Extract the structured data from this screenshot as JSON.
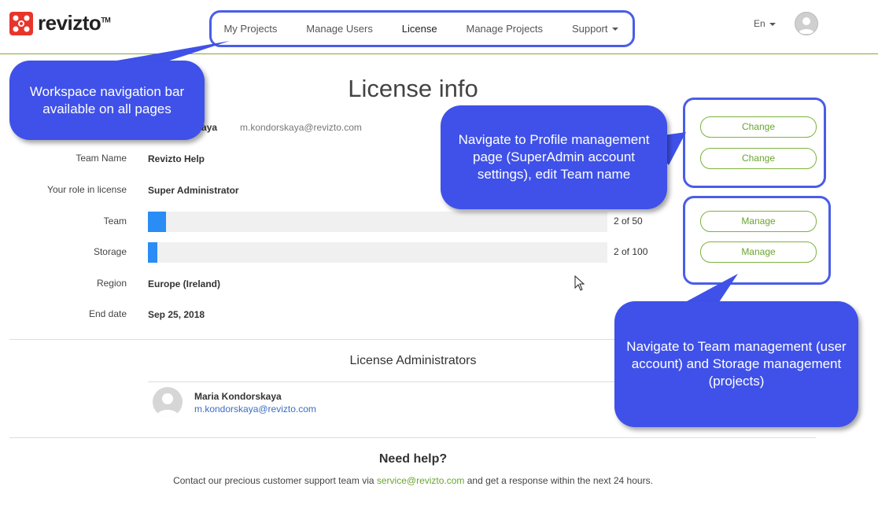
{
  "header": {
    "logo_text": "revizto",
    "logo_tm": "TM",
    "nav": [
      {
        "label": "My Projects"
      },
      {
        "label": "Manage Users"
      },
      {
        "label": "License"
      },
      {
        "label": "Manage Projects"
      },
      {
        "label": "Support"
      }
    ],
    "language": "En",
    "accent_color": "#8aa63a"
  },
  "main": {
    "title": "License info",
    "owner": {
      "name": "Maria Kondorskaya",
      "name_visible": "rskaya",
      "email": "m.kondorskaya@revizto.com"
    },
    "rows": {
      "team_name": {
        "label": "Team Name",
        "value": "Revizto Help"
      },
      "role": {
        "label": "Your role in license",
        "value": "Super Administrator"
      },
      "team": {
        "label": "Team",
        "usage_text": "2 of 50",
        "used": 2,
        "total": 50
      },
      "storage": {
        "label": "Storage",
        "usage_text": "2 of 100",
        "used": 2,
        "total": 100
      },
      "region": {
        "label": "Region",
        "value": "Europe (Ireland)"
      },
      "end_date": {
        "label": "End date",
        "value": "Sep 25, 2018"
      }
    },
    "buttons": {
      "change_profile": "Change",
      "change_team_name": "Change",
      "manage_team": "Manage",
      "manage_storage": "Manage"
    },
    "admins": {
      "title": "License Administrators",
      "items": [
        {
          "name": "Maria Kondorskaya",
          "email": "m.kondorskaya@revizto.com"
        }
      ]
    },
    "help": {
      "title": "Need help?",
      "text_before": "Contact our precious customer support team via ",
      "link": "service@revizto.com",
      "text_after": " and get a response within the next 24 hours."
    }
  },
  "annotations": {
    "nav_callout": "Workspace navigation bar available on all pages",
    "profile_callout": "Navigate to Profile management page (SuperAdmin account settings), edit Team name",
    "team_callout": "Navigate to Team management (user account) and Storage management (projects)",
    "callout_color": "#3f51e8"
  }
}
